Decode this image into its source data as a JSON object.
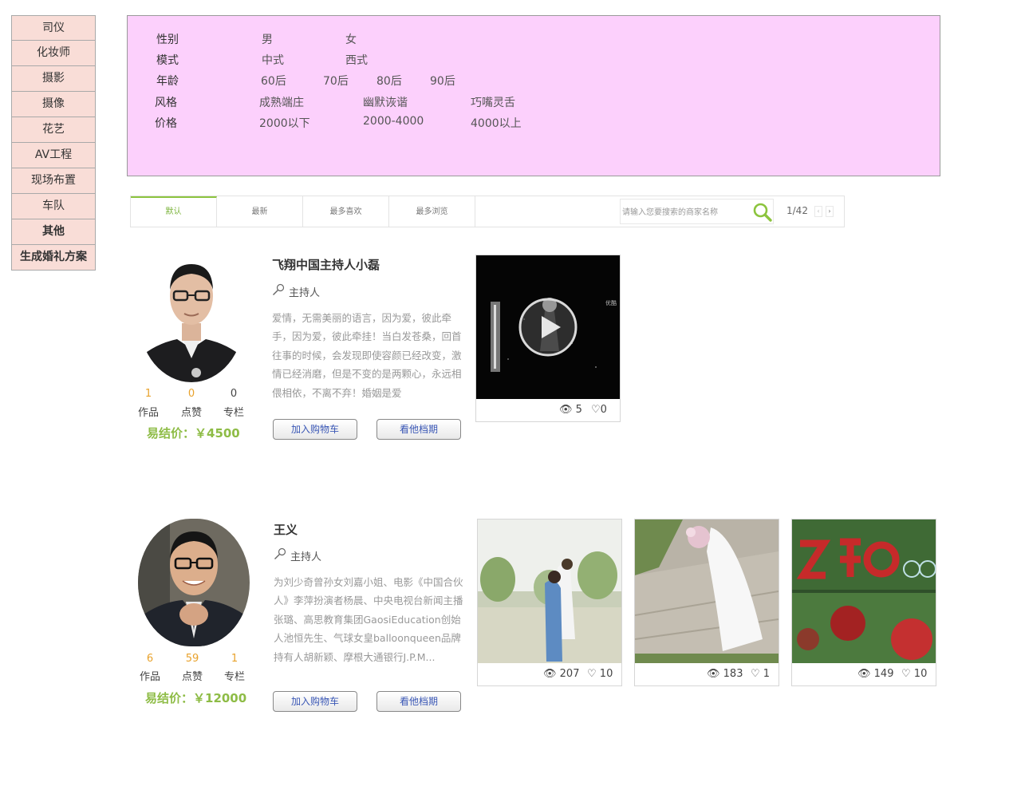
{
  "sidebar": {
    "items": [
      {
        "label": "司仪",
        "bold": false
      },
      {
        "label": "化妆师",
        "bold": false
      },
      {
        "label": "摄影",
        "bold": false
      },
      {
        "label": "摄像",
        "bold": false
      },
      {
        "label": "花艺",
        "bold": false
      },
      {
        "label": "AV工程",
        "bold": false
      },
      {
        "label": "现场布置",
        "bold": false
      },
      {
        "label": "车队",
        "bold": false
      },
      {
        "label": "其他",
        "bold": true
      },
      {
        "label": "生成婚礼方案",
        "bold": true
      }
    ]
  },
  "filters": {
    "gender": {
      "label": "性别",
      "options": [
        "男",
        "女"
      ]
    },
    "style_mode": {
      "label": "模式",
      "options": [
        "中式",
        "西式"
      ]
    },
    "age": {
      "label": "年龄",
      "options": [
        "60后",
        "70后",
        "80后",
        "90后"
      ]
    },
    "style": {
      "label": "风格",
      "options": [
        "成熟端庄",
        "幽默诙谐",
        "巧嘴灵舌"
      ]
    },
    "price": {
      "label": "价格",
      "options": [
        "2000以下",
        "2000-4000",
        "4000以上"
      ]
    }
  },
  "sortbar": {
    "tabs": [
      "默认",
      "最新",
      "最多喜欢",
      "最多浏览"
    ],
    "active_tab": 0,
    "search_placeholder": "请输入您要搜索的商家名称",
    "pager": "1/42",
    "prev": "‹",
    "next": "›"
  },
  "labels": {
    "works": "作品",
    "likes": "点赞",
    "columns": "专栏",
    "add_cart": "加入购物车",
    "schedule": "看他档期"
  },
  "vendors": [
    {
      "name": "飞翔中国主持人小磊",
      "role": "主持人",
      "description": "爱情，无需美丽的语言，因为爱，彼此牵手，因为爱，彼此牵挂！当白发苍桑，回首往事的时候，会发现即使容颜已经改变，激情已经消磨，但是不变的是两颗心，永远相偎相依，不离不弃！婚姻是爱",
      "stats": {
        "works": "1",
        "likes": "0",
        "columns": "0"
      },
      "price": "易结价：￥4500",
      "media": [
        {
          "type": "video",
          "views": "5",
          "likes": "0",
          "badge": "优酷"
        }
      ]
    },
    {
      "name": "王义",
      "role": "主持人",
      "description": "为刘少奇曾孙女刘嘉小姐、电影《中国合伙人》李萍扮演者杨晨、中央电视台新闻主播张璐、高思教育集团GaosiEducation创始人池恒先生、气球女皇balloonqueen品牌持有人胡新颖、摩根大通银行J.P.M...",
      "stats": {
        "works": "6",
        "likes": "59",
        "columns": "1"
      },
      "price": "易结价：￥12000",
      "media": [
        {
          "type": "photo",
          "views": "207",
          "likes": "10"
        },
        {
          "type": "photo",
          "views": "183",
          "likes": "1"
        },
        {
          "type": "photo",
          "views": "149",
          "likes": "10"
        }
      ]
    }
  ],
  "colors": {
    "accent_green": "#8ebc46",
    "stat_orange": "#e8a22c",
    "filter_bg": "#fcd0fc",
    "sidebar_bg": "#f9ddd7",
    "button_text": "#3a57b5"
  }
}
